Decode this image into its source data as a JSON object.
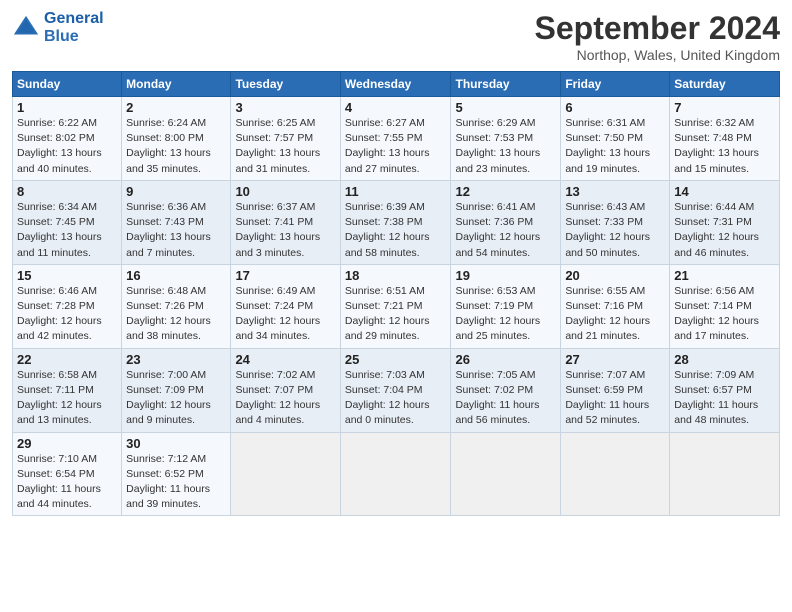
{
  "header": {
    "logo_line1": "General",
    "logo_line2": "Blue",
    "month_title": "September 2024",
    "location": "Northop, Wales, United Kingdom"
  },
  "weekdays": [
    "Sunday",
    "Monday",
    "Tuesday",
    "Wednesday",
    "Thursday",
    "Friday",
    "Saturday"
  ],
  "weeks": [
    [
      {
        "day": "1",
        "sunrise": "6:22 AM",
        "sunset": "8:02 PM",
        "daylight": "13 hours and 40 minutes."
      },
      {
        "day": "2",
        "sunrise": "6:24 AM",
        "sunset": "8:00 PM",
        "daylight": "13 hours and 35 minutes."
      },
      {
        "day": "3",
        "sunrise": "6:25 AM",
        "sunset": "7:57 PM",
        "daylight": "13 hours and 31 minutes."
      },
      {
        "day": "4",
        "sunrise": "6:27 AM",
        "sunset": "7:55 PM",
        "daylight": "13 hours and 27 minutes."
      },
      {
        "day": "5",
        "sunrise": "6:29 AM",
        "sunset": "7:53 PM",
        "daylight": "13 hours and 23 minutes."
      },
      {
        "day": "6",
        "sunrise": "6:31 AM",
        "sunset": "7:50 PM",
        "daylight": "13 hours and 19 minutes."
      },
      {
        "day": "7",
        "sunrise": "6:32 AM",
        "sunset": "7:48 PM",
        "daylight": "13 hours and 15 minutes."
      }
    ],
    [
      {
        "day": "8",
        "sunrise": "6:34 AM",
        "sunset": "7:45 PM",
        "daylight": "13 hours and 11 minutes."
      },
      {
        "day": "9",
        "sunrise": "6:36 AM",
        "sunset": "7:43 PM",
        "daylight": "13 hours and 7 minutes."
      },
      {
        "day": "10",
        "sunrise": "6:37 AM",
        "sunset": "7:41 PM",
        "daylight": "13 hours and 3 minutes."
      },
      {
        "day": "11",
        "sunrise": "6:39 AM",
        "sunset": "7:38 PM",
        "daylight": "12 hours and 58 minutes."
      },
      {
        "day": "12",
        "sunrise": "6:41 AM",
        "sunset": "7:36 PM",
        "daylight": "12 hours and 54 minutes."
      },
      {
        "day": "13",
        "sunrise": "6:43 AM",
        "sunset": "7:33 PM",
        "daylight": "12 hours and 50 minutes."
      },
      {
        "day": "14",
        "sunrise": "6:44 AM",
        "sunset": "7:31 PM",
        "daylight": "12 hours and 46 minutes."
      }
    ],
    [
      {
        "day": "15",
        "sunrise": "6:46 AM",
        "sunset": "7:28 PM",
        "daylight": "12 hours and 42 minutes."
      },
      {
        "day": "16",
        "sunrise": "6:48 AM",
        "sunset": "7:26 PM",
        "daylight": "12 hours and 38 minutes."
      },
      {
        "day": "17",
        "sunrise": "6:49 AM",
        "sunset": "7:24 PM",
        "daylight": "12 hours and 34 minutes."
      },
      {
        "day": "18",
        "sunrise": "6:51 AM",
        "sunset": "7:21 PM",
        "daylight": "12 hours and 29 minutes."
      },
      {
        "day": "19",
        "sunrise": "6:53 AM",
        "sunset": "7:19 PM",
        "daylight": "12 hours and 25 minutes."
      },
      {
        "day": "20",
        "sunrise": "6:55 AM",
        "sunset": "7:16 PM",
        "daylight": "12 hours and 21 minutes."
      },
      {
        "day": "21",
        "sunrise": "6:56 AM",
        "sunset": "7:14 PM",
        "daylight": "12 hours and 17 minutes."
      }
    ],
    [
      {
        "day": "22",
        "sunrise": "6:58 AM",
        "sunset": "7:11 PM",
        "daylight": "12 hours and 13 minutes."
      },
      {
        "day": "23",
        "sunrise": "7:00 AM",
        "sunset": "7:09 PM",
        "daylight": "12 hours and 9 minutes."
      },
      {
        "day": "24",
        "sunrise": "7:02 AM",
        "sunset": "7:07 PM",
        "daylight": "12 hours and 4 minutes."
      },
      {
        "day": "25",
        "sunrise": "7:03 AM",
        "sunset": "7:04 PM",
        "daylight": "12 hours and 0 minutes."
      },
      {
        "day": "26",
        "sunrise": "7:05 AM",
        "sunset": "7:02 PM",
        "daylight": "11 hours and 56 minutes."
      },
      {
        "day": "27",
        "sunrise": "7:07 AM",
        "sunset": "6:59 PM",
        "daylight": "11 hours and 52 minutes."
      },
      {
        "day": "28",
        "sunrise": "7:09 AM",
        "sunset": "6:57 PM",
        "daylight": "11 hours and 48 minutes."
      }
    ],
    [
      {
        "day": "29",
        "sunrise": "7:10 AM",
        "sunset": "6:54 PM",
        "daylight": "11 hours and 44 minutes."
      },
      {
        "day": "30",
        "sunrise": "7:12 AM",
        "sunset": "6:52 PM",
        "daylight": "11 hours and 39 minutes."
      },
      null,
      null,
      null,
      null,
      null
    ]
  ]
}
